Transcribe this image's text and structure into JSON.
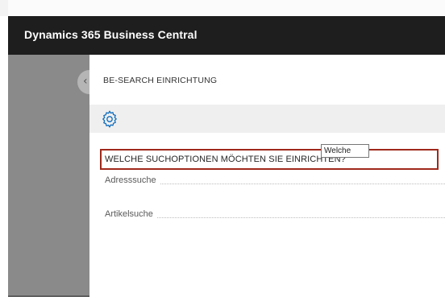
{
  "app": {
    "title": "Dynamics 365 Business Central"
  },
  "panel": {
    "title": "BE-SEARCH EINRICHTUNG",
    "actions": [
      {
        "icon": "gear-icon"
      }
    ],
    "group": {
      "header": "WELCHE SUCHOPTIONEN MÖCHTEN SIE EINRICHTEN?",
      "fields": [
        {
          "label": "Adresssuche"
        },
        {
          "label": "Artikelsuche"
        }
      ]
    },
    "tooltip": "Welche"
  },
  "colors": {
    "appbar": "#1e1e1e",
    "highlight_border": "#a0291c",
    "actionbar": "#efefef",
    "gear": "#0f6cbd"
  }
}
